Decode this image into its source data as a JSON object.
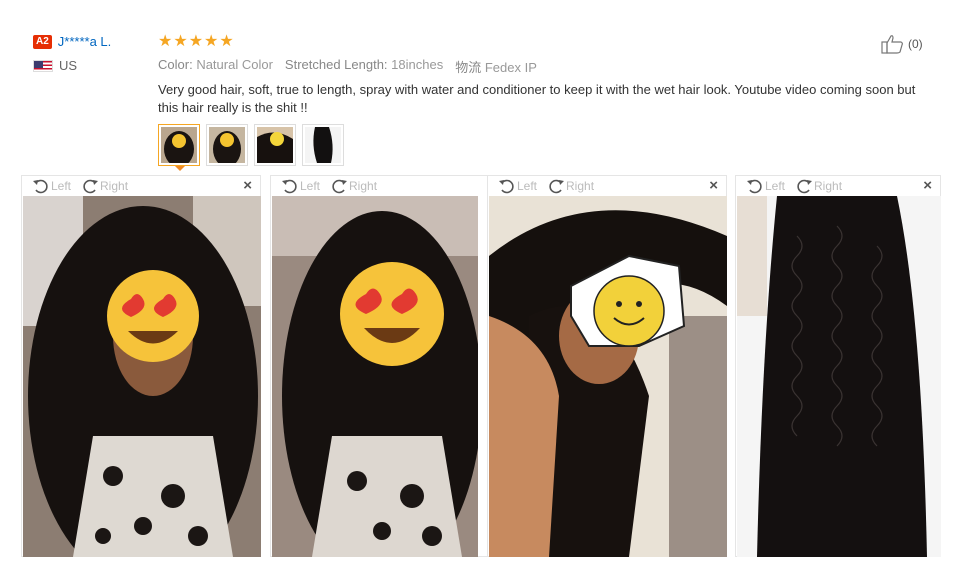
{
  "user": {
    "badge": "A2",
    "name": "J*****a L.",
    "country": "US"
  },
  "rating": {
    "stars": 5
  },
  "attributes": [
    {
      "key": "Color:",
      "value": "Natural Color"
    },
    {
      "key": "Stretched Length:",
      "value": "18inches"
    },
    {
      "key": "物流",
      "value": "Fedex IP"
    }
  ],
  "review_text": "Very good hair, soft, true to length, spray with water and conditioner to keep it with the wet hair look. Youtube video coming soon but this hair really is the shit !!",
  "helpful": {
    "count": "(0)"
  },
  "viewer_controls": {
    "left_label": "Left",
    "right_label": "Right",
    "close": "×"
  },
  "colors": {
    "accent": "#f5a623",
    "link": "#0066c0",
    "badge": "#e62e04"
  },
  "icons": [
    "thumbs-up-icon",
    "rotate-left-icon",
    "rotate-right-icon",
    "close-icon",
    "star-icon",
    "flag-icon"
  ]
}
